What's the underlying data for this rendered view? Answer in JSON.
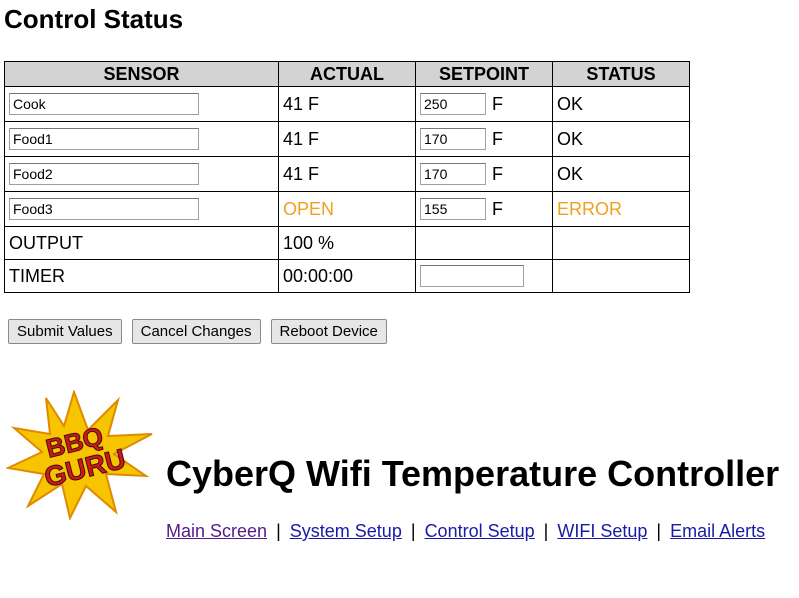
{
  "page": {
    "title": "Control Status"
  },
  "table": {
    "headers": {
      "sensor": "SENSOR",
      "actual": "ACTUAL",
      "setpoint": "SETPOINT",
      "status": "STATUS"
    },
    "sensors": [
      {
        "name": "Cook",
        "actual": "41 F",
        "setpoint": "250",
        "unit": "F",
        "status": "OK"
      },
      {
        "name": "Food1",
        "actual": "41 F",
        "setpoint": "170",
        "unit": "F",
        "status": "OK"
      },
      {
        "name": "Food2",
        "actual": "41 F",
        "setpoint": "170",
        "unit": "F",
        "status": "OK"
      },
      {
        "name": "Food3",
        "actual": "OPEN",
        "setpoint": "155",
        "unit": "F",
        "status": "ERROR"
      }
    ],
    "output": {
      "label": "OUTPUT",
      "value": "100 %"
    },
    "timer": {
      "label": "TIMER",
      "value": "00:00:00",
      "input_value": ""
    }
  },
  "buttons": {
    "submit": "Submit Values",
    "cancel": "Cancel Changes",
    "reboot": "Reboot Device"
  },
  "logo": {
    "line1": "BBQ",
    "line2": "GURU"
  },
  "app_title": "CyberQ Wifi Temperature Controller",
  "nav": {
    "main": "Main Screen",
    "system": "System Setup",
    "control": "Control Setup",
    "wifi": "WIFI Setup",
    "email": "Email Alerts",
    "separator": "|"
  },
  "colors": {
    "warning": "#f0a020",
    "header_bg": "#d3d3d3",
    "link": "#1a1aa6",
    "link_visited": "#551a8b"
  }
}
